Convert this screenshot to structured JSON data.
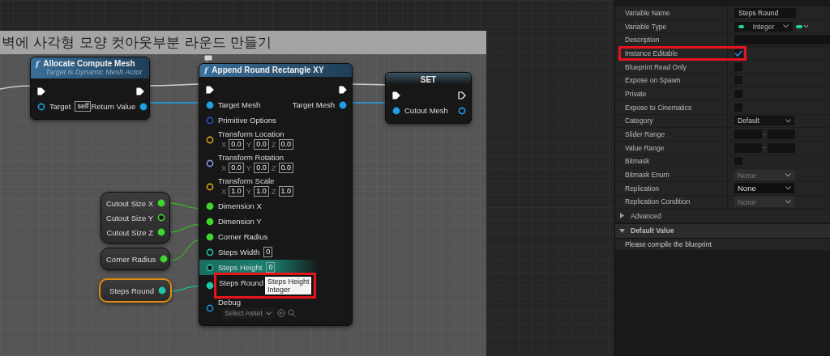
{
  "graph": {
    "comment": {
      "title": "벽에 사각형 모양 컷아웃부분 라운드 만들기"
    },
    "nodes": [
      {
        "kind": "function",
        "icon": "f",
        "title": "Allocate Compute Mesh",
        "subtitle": "Target is Dynamic Mesh Actor",
        "selected": false,
        "rows": [
          {
            "hovered": false,
            "left": {
              "kind": "exec",
              "connected": true
            },
            "right": {
              "kind": "exec",
              "connected": true
            }
          },
          {
            "hovered": false,
            "left": {
              "kind": "data",
              "label": "Target",
              "color": "#1ea0e8",
              "connected": false,
              "value": "self"
            },
            "right": {
              "kind": "data",
              "label": "Return Value",
              "color": "#1ea0e8",
              "connected": true
            }
          }
        ]
      },
      {
        "kind": "function",
        "icon": "f",
        "title": "Append Round Rectangle XY",
        "selected": false,
        "rows": [
          {
            "hovered": false,
            "left": {
              "kind": "exec",
              "connected": true
            },
            "right": {
              "kind": "exec",
              "connected": true
            }
          },
          {
            "hovered": false,
            "left": {
              "kind": "data",
              "label": "Target Mesh",
              "color": "#1ea0e8",
              "connected": true
            },
            "right": {
              "kind": "data",
              "label": "Target Mesh",
              "color": "#1ea0e8",
              "connected": true
            }
          },
          {
            "hovered": false,
            "left": {
              "kind": "data",
              "label": "Primitive Options",
              "color": "#2357b8",
              "connected": false
            }
          },
          {
            "hovered": false,
            "left": {
              "kind": "data",
              "label": "Transform Location",
              "color": "#d9a423",
              "connected": false,
              "vector": [
                {
                  "axis": "X",
                  "value": "0.0"
                },
                {
                  "axis": "Y",
                  "value": "0.0"
                },
                {
                  "axis": "Z",
                  "value": "0.0"
                }
              ]
            }
          },
          {
            "hovered": false,
            "left": {
              "kind": "data",
              "label": "Transform Rotation",
              "color": "#8e96e6",
              "connected": false,
              "vector": [
                {
                  "axis": "X",
                  "value": "0.0"
                },
                {
                  "axis": "Y",
                  "value": "0.0"
                },
                {
                  "axis": "Z",
                  "value": "0.0"
                }
              ]
            }
          },
          {
            "hovered": false,
            "left": {
              "kind": "data",
              "label": "Transform Scale",
              "color": "#d9a423",
              "connected": false,
              "vector": [
                {
                  "axis": "X",
                  "value": "1.0"
                },
                {
                  "axis": "Y",
                  "value": "1.0"
                },
                {
                  "axis": "Z",
                  "value": "1.0"
                }
              ]
            }
          },
          {
            "hovered": false,
            "left": {
              "kind": "data",
              "label": "Dimension X",
              "color": "#3fd62c",
              "connected": true
            }
          },
          {
            "hovered": false,
            "left": {
              "kind": "data",
              "label": "Dimension Y",
              "color": "#3fd62c",
              "connected": true
            }
          },
          {
            "hovered": false,
            "left": {
              "kind": "data",
              "label": "Corner Radius",
              "color": "#3fd62c",
              "connected": true
            }
          },
          {
            "hovered": false,
            "left": {
              "kind": "data",
              "label": "Steps Width",
              "color": "#1fc7a7",
              "connected": false,
              "value": "0"
            }
          },
          {
            "hovered": true,
            "left": {
              "kind": "data",
              "label": "Steps Height",
              "color": "#1fc7a7",
              "connected": false,
              "value": "0"
            }
          },
          {
            "hovered": false,
            "left": {
              "kind": "data",
              "label": "Steps Round",
              "color": "#1fc7a7",
              "connected": true,
              "tooltip": {
                "title": "Steps Height",
                "subtitle": "Integer",
                "highlighted": true
              }
            }
          },
          {
            "hovered": false,
            "left": {
              "kind": "data",
              "label": "Debug",
              "color": "#1a8fd8",
              "connected": false,
              "asset": "Select Asset"
            }
          }
        ]
      },
      {
        "kind": "set",
        "title": "SET",
        "selected": false,
        "rows": [
          {
            "hovered": false,
            "left": {
              "kind": "exec",
              "connected": true
            },
            "right": {
              "kind": "exec",
              "connected": false
            }
          },
          {
            "hovered": false,
            "left": {
              "kind": "data",
              "label": "Cutout Mesh",
              "color": "#1ea0e8",
              "connected": true
            },
            "right": {
              "kind": "data",
              "color": "#1ea0e8",
              "connected": false
            }
          }
        ]
      },
      {
        "kind": "getter",
        "selected": false,
        "rows": [
          {
            "hovered": false,
            "right": {
              "kind": "data",
              "label": "Cutout Size X",
              "color": "#3fd62c",
              "connected": true
            }
          },
          {
            "hovered": false,
            "right": {
              "kind": "data",
              "label": "Cutout Size Y",
              "color": "#3fd62c",
              "connected": false
            }
          },
          {
            "hovered": false,
            "right": {
              "kind": "data",
              "label": "Cutout Size Z",
              "color": "#3fd62c",
              "connected": true
            }
          }
        ]
      },
      {
        "kind": "getter",
        "selected": false,
        "rows": [
          {
            "hovered": false,
            "right": {
              "kind": "data",
              "label": "Corner Radius",
              "color": "#3fd62c",
              "connected": true
            }
          }
        ]
      },
      {
        "kind": "getter",
        "selected": true,
        "rows": [
          {
            "hovered": false,
            "right": {
              "kind": "data",
              "label": "Steps Round",
              "color": "#1fc7a7",
              "connected": true
            }
          }
        ]
      }
    ]
  },
  "details": {
    "rows": [
      {
        "label": "Variable Name",
        "kind": "text",
        "value": "Steps Round",
        "highlighted": false
      },
      {
        "label": "Variable Type",
        "kind": "type",
        "value": "Integer",
        "highlighted": false
      },
      {
        "label": "Description",
        "kind": "field",
        "highlighted": false
      },
      {
        "label": "Instance Editable",
        "kind": "checkbox",
        "checked": true,
        "highlighted": true
      },
      {
        "label": "Blueprint Read Only",
        "kind": "checkbox",
        "checked": false,
        "highlighted": false
      },
      {
        "label": "Expose on Spawn",
        "kind": "checkbox",
        "checked": false,
        "highlighted": false
      },
      {
        "label": "Private",
        "kind": "checkbox",
        "checked": false,
        "highlighted": false
      },
      {
        "label": "Expose to Cinematics",
        "kind": "checkbox",
        "checked": false,
        "highlighted": false
      },
      {
        "label": "Category",
        "kind": "combo",
        "value": "Default",
        "highlighted": false
      },
      {
        "label": "Slider Range",
        "kind": "range",
        "highlighted": false
      },
      {
        "label": "Value Range",
        "kind": "range",
        "highlighted": false
      },
      {
        "label": "Bitmask",
        "kind": "checkbox",
        "checked": false,
        "highlighted": false
      },
      {
        "label": "Bitmask Enum",
        "kind": "dropdown",
        "value": "None",
        "disabled": true,
        "highlighted": false
      },
      {
        "label": "Replication",
        "kind": "dropdown",
        "value": "None",
        "disabled": false,
        "highlighted": false
      },
      {
        "label": "Replication Condition",
        "kind": "dropdown",
        "value": "None",
        "disabled": true,
        "highlighted": false
      }
    ],
    "sections": [
      {
        "title": "Advanced",
        "expanded": false
      },
      {
        "title": "Default Value",
        "expanded": true,
        "text": "Please compile the blueprint"
      }
    ]
  }
}
